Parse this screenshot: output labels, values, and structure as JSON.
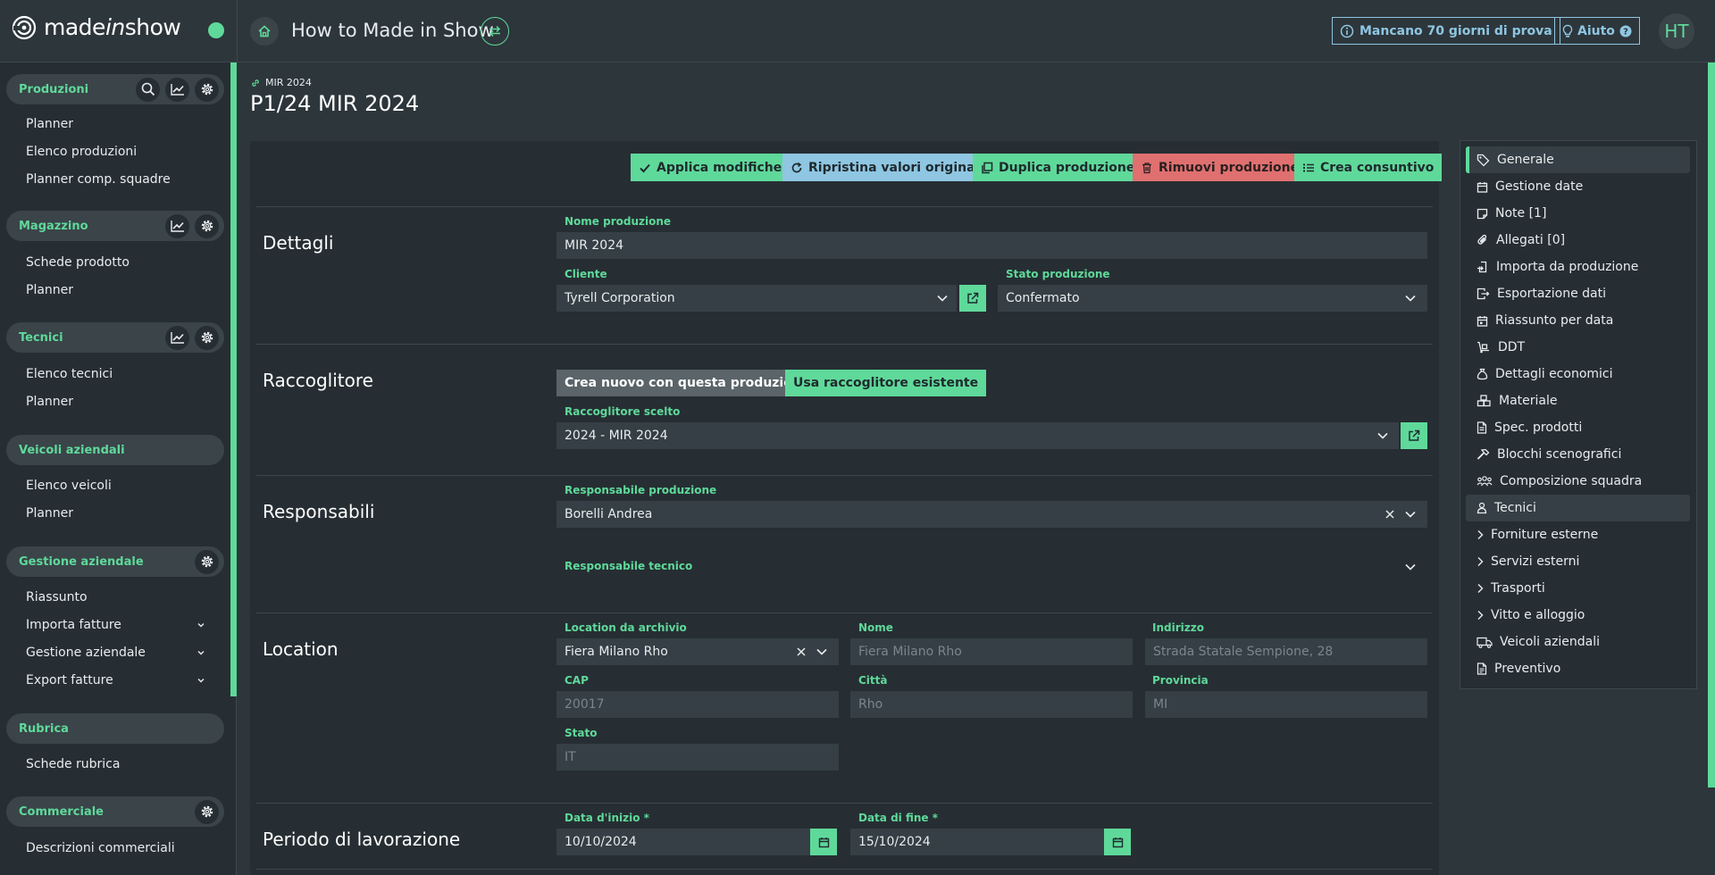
{
  "header": {
    "brand_pre": "made",
    "brand_italic": "in",
    "brand_post": "show",
    "app_title": "How to Made in Show",
    "trial_text": "Mancano 70 giorni di prova",
    "help_label": "Aiuto",
    "avatar_initials": "HT"
  },
  "sidebar": {
    "groups": [
      {
        "title": "Produzioni",
        "items": [
          "Planner",
          "Elenco produzioni",
          "Planner comp. squadre"
        ]
      },
      {
        "title": "Magazzino",
        "items": [
          "Schede prodotto",
          "Planner"
        ]
      },
      {
        "title": "Tecnici",
        "items": [
          "Elenco tecnici",
          "Planner"
        ]
      },
      {
        "title": "Veicoli aziendali",
        "items": [
          "Elenco veicoli",
          "Planner"
        ]
      },
      {
        "title": "Gestione aziendale",
        "items": [
          "Riassunto",
          "Importa fatture",
          "Gestione aziendale",
          "Export fatture"
        ]
      },
      {
        "title": "Rubrica",
        "items": [
          "Schede rubrica"
        ]
      },
      {
        "title": "Commerciale",
        "items": [
          "Descrizioni commerciali"
        ]
      }
    ]
  },
  "page": {
    "breadcrumb": "MIR 2024",
    "title": "P1/24 MIR 2024"
  },
  "toolbar": {
    "apply": "Applica modifiche",
    "reset": "Ripristina valori originali",
    "duplicate": "Duplica produzione",
    "remove": "Rimuovi produzione",
    "consuntivo": "Crea consuntivo"
  },
  "dettagli": {
    "title": "Dettagli",
    "nome_label": "Nome produzione",
    "nome_value": "MIR 2024",
    "cliente_label": "Cliente",
    "cliente_value": "Tyrell Corporation",
    "stato_label": "Stato produzione",
    "stato_value": "Confermato"
  },
  "raccoglitore": {
    "title": "Raccoglitore",
    "option_new": "Crea nuovo con questa produzione",
    "option_existing": "Usa raccoglitore esistente",
    "scelto_label": "Raccoglitore scelto",
    "scelto_value": "2024 - MIR 2024"
  },
  "responsabili": {
    "title": "Responsabili",
    "prod_label": "Responsabile produzione",
    "prod_value": "Borelli Andrea",
    "tech_label": "Responsabile tecnico"
  },
  "location": {
    "title": "Location",
    "archivio_label": "Location da archivio",
    "archivio_value": "Fiera Milano Rho",
    "nome_label": "Nome",
    "nome_value": "Fiera Milano Rho",
    "indirizzo_label": "Indirizzo",
    "indirizzo_value": "Strada Statale Sempione, 28",
    "cap_label": "CAP",
    "cap_value": "20017",
    "citta_label": "Città",
    "citta_value": "Rho",
    "provincia_label": "Provincia",
    "provincia_value": "MI",
    "stato_label": "Stato",
    "stato_value": "IT"
  },
  "periodo": {
    "title": "Periodo di lavorazione",
    "inizio_label": "Data d'inizio *",
    "inizio_value": "10/10/2024",
    "fine_label": "Data di fine *",
    "fine_value": "15/10/2024"
  },
  "right_nav": [
    {
      "label": "Generale",
      "icon": "tag-icon"
    },
    {
      "label": "Gestione date",
      "icon": "calendar-icon"
    },
    {
      "label": "Note [1]",
      "icon": "note-icon"
    },
    {
      "label": "Allegati [0]",
      "icon": "paperclip-icon"
    },
    {
      "label": "Importa da produzione",
      "icon": "import-icon"
    },
    {
      "label": "Esportazione dati",
      "icon": "export-icon"
    },
    {
      "label": "Riassunto per data",
      "icon": "calendar-day-icon"
    },
    {
      "label": "DDT",
      "icon": "dolly-icon"
    },
    {
      "label": "Dettagli economici",
      "icon": "money-bag-icon"
    },
    {
      "label": "Materiale",
      "icon": "boxes-icon"
    },
    {
      "label": "Spec. prodotti",
      "icon": "document-icon"
    },
    {
      "label": "Blocchi scenografici",
      "icon": "hammer-icon"
    },
    {
      "label": "Composizione squadra",
      "icon": "people-icon"
    },
    {
      "label": "Tecnici",
      "icon": "person-icon"
    },
    {
      "label": "Forniture esterne",
      "icon": "chevron-right-icon"
    },
    {
      "label": "Servizi esterni",
      "icon": "chevron-right-icon"
    },
    {
      "label": "Trasporti",
      "icon": "chevron-right-icon"
    },
    {
      "label": "Vitto e alloggio",
      "icon": "chevron-right-icon"
    },
    {
      "label": "Veicoli aziendali",
      "icon": "truck-icon"
    },
    {
      "label": "Preventivo",
      "icon": "invoice-icon"
    }
  ],
  "colors": {
    "accent": "#5fd99a",
    "info": "#8fc6e2",
    "danger": "#e07070",
    "background": "#2d363b",
    "panel": "#262e33"
  }
}
